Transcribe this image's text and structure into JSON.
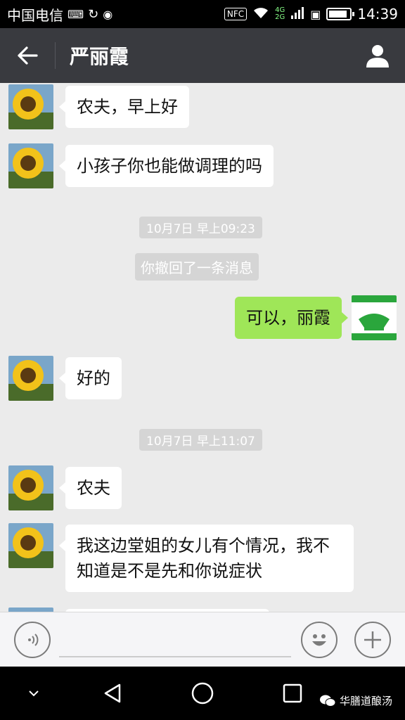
{
  "status_bar": {
    "carrier": "中国电信",
    "nfc": "NFC",
    "net_4g": "4G",
    "net_2g": "2G",
    "battery_level": 0.9,
    "time": "14:39"
  },
  "header": {
    "title": "严丽霞"
  },
  "messages": {
    "m1": "农夫，早上好",
    "m2": "小孩子你也能做调理的吗",
    "time1": "10月7日 早上09:23",
    "recalled": "你撤回了一条消息",
    "m3_out": "可以，丽霞",
    "m4": "好的",
    "time2": "10月7日 早上11:07",
    "m5": "农夫",
    "m6": "我这边堂姐的女儿有个情况，我不知道是不是先和你说症状"
  },
  "watermark": {
    "label": "华膳道酿汤"
  },
  "colors": {
    "incoming_bubble": "#ffffff",
    "outgoing_bubble": "#9fe658",
    "header_bg": "#393a3f",
    "chat_bg": "#ebebeb"
  }
}
